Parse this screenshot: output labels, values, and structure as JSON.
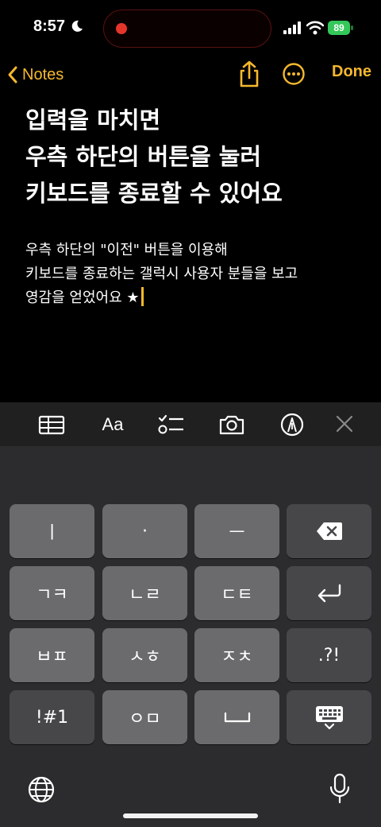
{
  "status_bar": {
    "time": "8:57",
    "battery": "89"
  },
  "nav": {
    "back_label": "Notes",
    "done_label": "Done"
  },
  "note": {
    "title_lines": [
      "입력을 마치면",
      "우측 하단의 버튼을 눌러",
      "키보드를 종료할 수 있어요"
    ],
    "body_lines": [
      "우측 하단의 \"이전\" 버튼을 이용해",
      "키보드를 종료하는 갤럭시 사용자 분들을 보고",
      "영감을 얻었어요 ★"
    ]
  },
  "toolbar": {
    "text_format_label": "Aa"
  },
  "keyboard": {
    "rows": [
      [
        "ㅣ",
        "·",
        "ㅡ",
        ""
      ],
      [
        "ㄱㅋ",
        "ㄴㄹ",
        "ㄷㅌ",
        ""
      ],
      [
        "ㅂㅍ",
        "ㅅㅎ",
        "ㅈㅊ",
        ".?!"
      ],
      [
        "!#1",
        "ㅇㅁ",
        "",
        ""
      ]
    ]
  },
  "colors": {
    "accent": "#f5b82e",
    "background": "#000000",
    "key": "#6b6b6d",
    "key_dark": "#474749",
    "recording": "#e5352b",
    "battery": "#34c759"
  }
}
